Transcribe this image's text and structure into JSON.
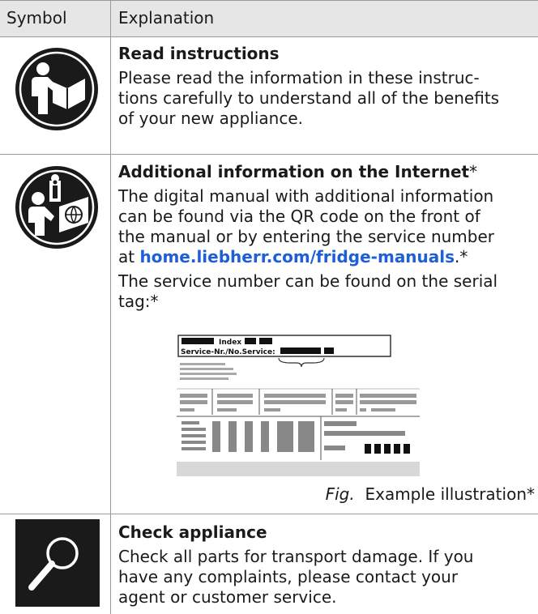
{
  "header": {
    "symbol": "Symbol",
    "explanation": "Explanation"
  },
  "rows": [
    {
      "icon": "read-instructions-icon",
      "title": "Read instructions",
      "body": "Please read the information in these instructions carefully to understand all of the benefits of your new appliance.",
      "body_lines": [
        "Please read the information in these instruc-",
        "tions carefully to understand all of the benefits",
        "of your new appliance."
      ]
    },
    {
      "icon": "internet-information-icon",
      "title": "Additional information on the Internet",
      "title_suffix": "*",
      "body_lines": [
        "The digital manual with additional information",
        "can be found via the QR code on the front of",
        "the manual or by entering the service number"
      ],
      "body_prefix": "at ",
      "link": "home.liebherr.com/fridge-manuals",
      "body_suffix": ".*",
      "body2_lines": [
        "The service number can be found on the serial",
        "tag:*"
      ],
      "tag": {
        "index_label": "Index",
        "service_label": "Service-Nr./No.Service:"
      },
      "caption_fig": "Fig.",
      "caption_text": "Example illustration*"
    },
    {
      "icon": "magnifier-icon",
      "title": "Check appliance",
      "body_lines": [
        "Check all parts for transport damage. If you",
        "have any complaints, please contact your",
        "agent or customer service."
      ]
    }
  ],
  "colors": {
    "header_bg": "#e6e6e6",
    "link": "#1e5fd6",
    "icon_dark": "#1a1a1a"
  }
}
